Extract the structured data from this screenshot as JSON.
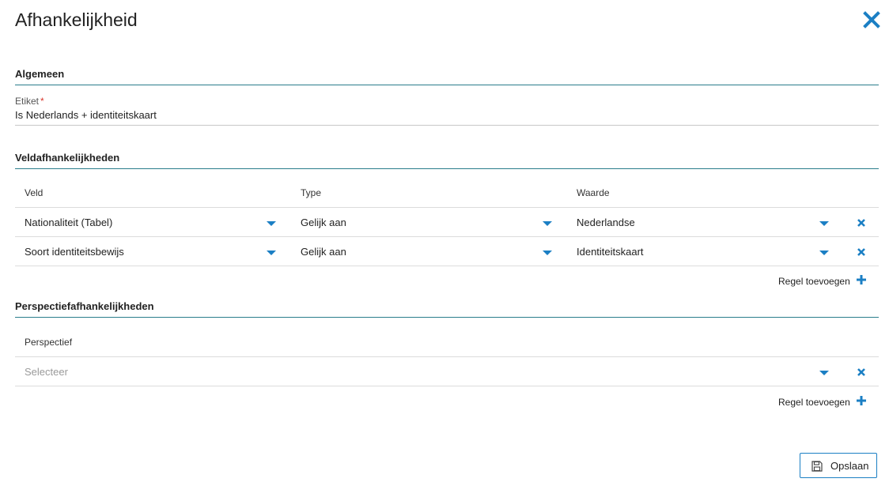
{
  "dialog": {
    "title": "Afhankelijkheid"
  },
  "general": {
    "heading": "Algemeen",
    "label_field": {
      "label": "Etiket",
      "required_mark": "*",
      "value": "Is Nederlands + identiteitskaart"
    }
  },
  "field_dependencies": {
    "heading": "Veldafhankelijkheden",
    "columns": [
      "Veld",
      "Type",
      "Waarde"
    ],
    "rows": [
      {
        "field": "Nationaliteit (Tabel)",
        "type": "Gelijk aan",
        "value": "Nederlandse"
      },
      {
        "field": "Soort identiteitsbewijs",
        "type": "Gelijk aan",
        "value": "Identiteitskaart"
      }
    ],
    "add_label": "Regel toevoegen"
  },
  "perspective_dependencies": {
    "heading": "Perspectiefafhankelijkheden",
    "column": "Perspectief",
    "select_placeholder": "Selecteer",
    "add_label": "Regel toevoegen"
  },
  "footer": {
    "save_label": "Opslaan"
  },
  "colors": {
    "accent": "#1b7fc4",
    "section_rule": "#2a7d8c",
    "required": "#d9342b"
  }
}
